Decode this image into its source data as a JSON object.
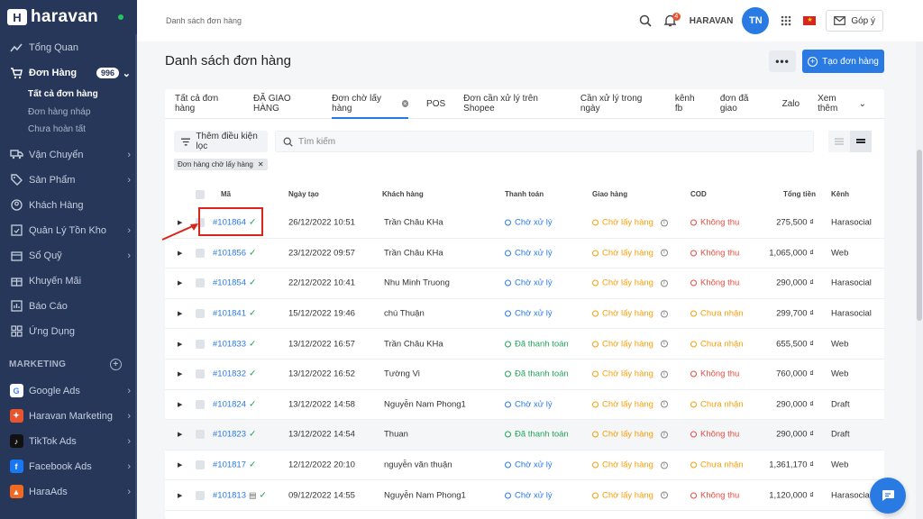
{
  "brand": {
    "name": "haravan"
  },
  "sidebar": {
    "items": [
      {
        "label": "Tổng Quan"
      },
      {
        "label": "Đơn Hàng",
        "badge": "996"
      },
      {
        "label": "Vận Chuyển"
      },
      {
        "label": "Sản Phẩm"
      },
      {
        "label": "Khách Hàng"
      },
      {
        "label": "Quản Lý Tồn Kho"
      },
      {
        "label": "Sổ Quỹ"
      },
      {
        "label": "Khuyến Mãi"
      },
      {
        "label": "Báo Cáo"
      },
      {
        "label": "Ứng Dụng"
      }
    ],
    "sub_items": [
      {
        "label": "Tất cả đơn hàng"
      },
      {
        "label": "Đơn hàng nháp"
      },
      {
        "label": "Chưa hoàn tất"
      }
    ],
    "marketing_label": "MARKETING",
    "marketing": [
      {
        "label": "Google Ads",
        "color": "#ffffff"
      },
      {
        "label": "Haravan Marketing",
        "color": "#e8542e"
      },
      {
        "label": "TikTok Ads",
        "color": "#111111"
      },
      {
        "label": "Facebook Ads",
        "color": "#1877f2"
      },
      {
        "label": "HaraAds",
        "color": "#f26a22"
      }
    ]
  },
  "header": {
    "breadcrumb": "Danh sách đơn hàng",
    "notification_count": "4",
    "shop_name": "HARAVAN",
    "avatar_initials": "TN",
    "feedback_label": "Góp ý"
  },
  "page": {
    "title": "Danh sách đơn hàng",
    "more_label": "•••",
    "create_label": "Tạo đơn hàng"
  },
  "tabs": [
    {
      "label": "Tất cả đơn hàng"
    },
    {
      "label": "ĐÃ GIAO HÀNG"
    },
    {
      "label": "Đơn chờ lấy hàng"
    },
    {
      "label": "POS"
    },
    {
      "label": "Đơn cần xử lý trên Shopee"
    },
    {
      "label": "Cần xử lý trong ngày"
    },
    {
      "label": "kênh fb"
    },
    {
      "label": "đơn đã giao"
    },
    {
      "label": "Zalo"
    },
    {
      "label": "Xem thêm"
    }
  ],
  "filters": {
    "add_condition_label": "Thêm điều kiện lọc",
    "search_placeholder": "Tìm kiếm",
    "active_chip": "Đơn hàng chờ lấy hàng"
  },
  "table": {
    "columns": {
      "code": "Mã",
      "date": "Ngày tạo",
      "customer": "Khách hàng",
      "payment": "Thanh toán",
      "shipping": "Giao hàng",
      "cod": "COD",
      "total": "Tổng tiền",
      "channel": "Kênh"
    },
    "rows": [
      {
        "code": "#101864",
        "date": "26/12/2022 10:51",
        "customer": "Trần Châu KHa",
        "payment": "Chờ xử lý",
        "shipping": "Chờ lấy hàng",
        "cod": "Không thu",
        "total": "275,500 ₫",
        "channel": "Harasocial"
      },
      {
        "code": "#101856",
        "date": "23/12/2022 09:57",
        "customer": "Trần Châu KHa",
        "payment": "Chờ xử lý",
        "shipping": "Chờ lấy hàng",
        "cod": "Không thu",
        "total": "1,065,000 ₫",
        "channel": "Web"
      },
      {
        "code": "#101854",
        "date": "22/12/2022 10:41",
        "customer": "Nhu Minh Truong",
        "payment": "Chờ xử lý",
        "shipping": "Chờ lấy hàng",
        "cod": "Không thu",
        "total": "290,000 ₫",
        "channel": "Harasocial"
      },
      {
        "code": "#101841",
        "date": "15/12/2022 19:46",
        "customer": "chú Thuận",
        "payment": "Chờ xử lý",
        "shipping": "Chờ lấy hàng",
        "cod": "Chưa nhận",
        "total": "299,700 ₫",
        "channel": "Harasocial"
      },
      {
        "code": "#101833",
        "date": "13/12/2022 16:57",
        "customer": "Trần Châu KHa",
        "payment": "Đã thanh toán",
        "shipping": "Chờ lấy hàng",
        "cod": "Chưa nhận",
        "total": "655,500 ₫",
        "channel": "Web"
      },
      {
        "code": "#101832",
        "date": "13/12/2022 16:52",
        "customer": "Tường Vi",
        "payment": "Đã thanh toán",
        "shipping": "Chờ lấy hàng",
        "cod": "Không thu",
        "total": "760,000 ₫",
        "channel": "Web"
      },
      {
        "code": "#101824",
        "date": "13/12/2022 14:58",
        "customer": "Nguyễn Nam Phong1",
        "payment": "Chờ xử lý",
        "shipping": "Chờ lấy hàng",
        "cod": "Chưa nhận",
        "total": "290,000 ₫",
        "channel": "Draft"
      },
      {
        "code": "#101823",
        "date": "13/12/2022 14:54",
        "customer": "Thuan",
        "payment": "Đã thanh toán",
        "shipping": "Chờ lấy hàng",
        "cod": "Không thu",
        "total": "290,000 ₫",
        "channel": "Draft"
      },
      {
        "code": "#101817",
        "date": "12/12/2022 20:10",
        "customer": "nguyễn văn thuận",
        "payment": "Chờ xử lý",
        "shipping": "Chờ lấy hàng",
        "cod": "Chưa nhận",
        "total": "1,361,170 ₫",
        "channel": "Web"
      },
      {
        "code": "#101813",
        "date": "09/12/2022 14:55",
        "customer": "Nguyễn Nam Phong1",
        "payment": "Chờ xử lý",
        "shipping": "Chờ lấy hàng",
        "cod": "Không thu",
        "total": "1,120,000 ₫",
        "channel": "Harasocial"
      }
    ]
  }
}
